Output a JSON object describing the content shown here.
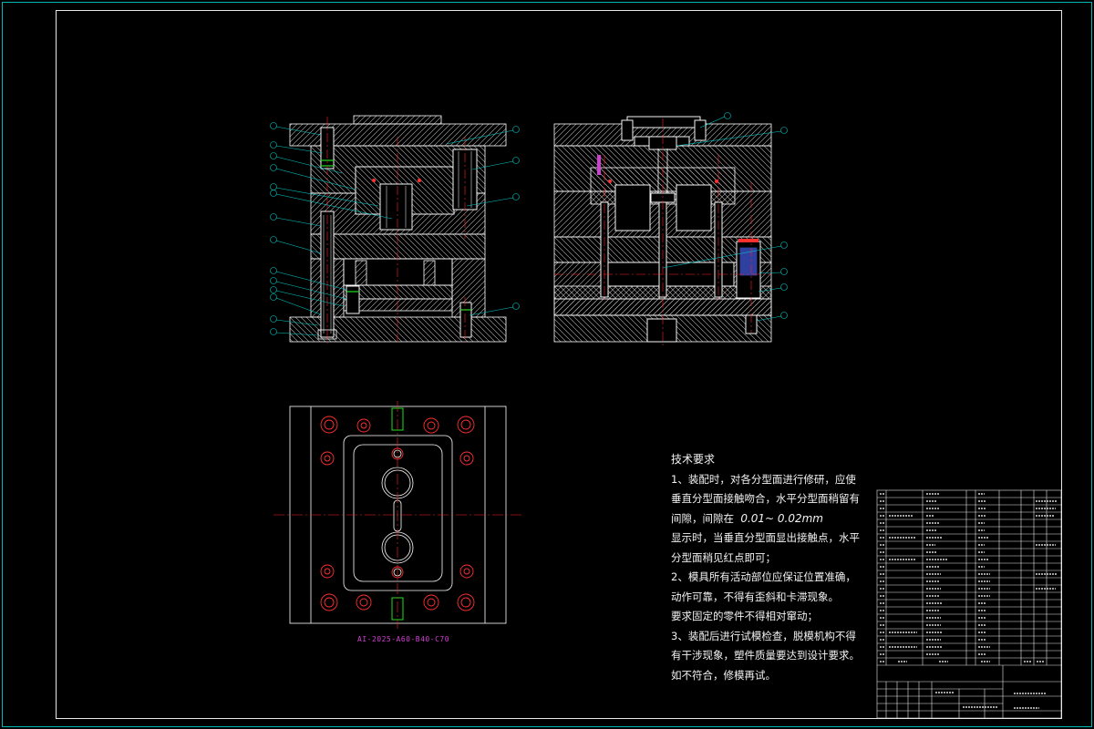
{
  "drawing": {
    "part_code": "AI-2025-A60-B40-C70",
    "colors": {
      "background": "#000000",
      "outline": "#ffffff",
      "frame": "#00b7b7",
      "hatch": "#c0c0c0",
      "centerline": "#ff2020",
      "leader": "#00c8c8",
      "pin": "#ff3030",
      "code": "#d040d0",
      "green": "#20e020"
    }
  },
  "tech_requirements": {
    "title": "技术要求",
    "lines": [
      "1、装配时，对各分型面进行修研，应使",
      "垂直分型面接触吻合，水平分型面稍留有",
      "间隙，间隙在",
      "显示时，当垂直分型面显出接触点，水平",
      "分型面稍见红点即可；",
      "2、模具所有活动部位应保证位置准确，",
      "动作可靠，不得有歪斜和卡滞现象。",
      "要求固定的零件不得相对窜动；",
      "3、装配后进行试模检查，脱模机构不得",
      "有干涉现象，塑件质量要达到设计要求。",
      "如不符合，修模再试。"
    ],
    "tolerance": "0.01~ 0.02mm"
  }
}
